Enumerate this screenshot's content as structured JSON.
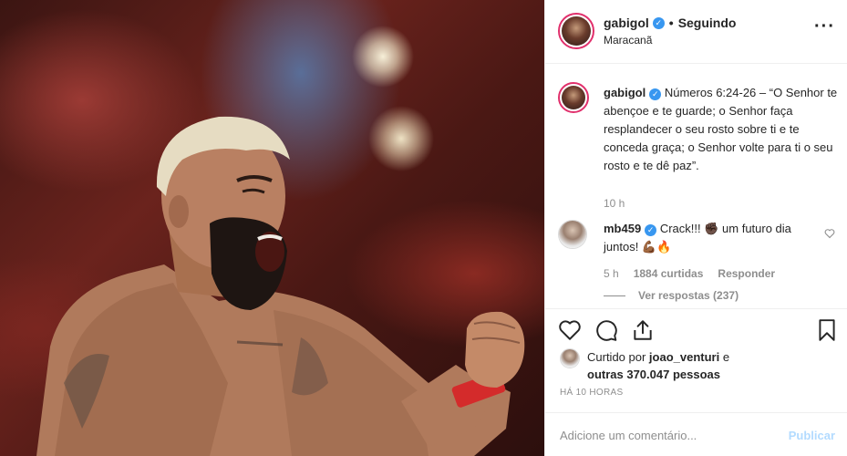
{
  "post": {
    "username": "gabigol",
    "follow_state": "Seguindo",
    "location": "Maracanã",
    "more_icon": "more-horizontal-icon"
  },
  "caption": {
    "username": "gabigol",
    "text": "Números 6:24-26 – “O Senhor te abençoe e te guarde; o Senhor faça resplandecer o seu rosto sobre ti e te conceda graça; o Senhor volte para ti o seu rosto e te dê paz”.",
    "time": "10 h"
  },
  "comment": {
    "username": "mb459",
    "text_part1": "Crack!!! ",
    "emoji1": "✊🏿",
    "text_part2": " um futuro dia juntos! ",
    "emoji2": "💪🏾🔥",
    "time": "5 h",
    "likes": "1884 curtidas",
    "reply_label": "Responder",
    "view_replies": "Ver respostas (237)"
  },
  "likes": {
    "prefix": "Curtido por ",
    "user": "joao_venturi",
    "middle": " e ",
    "others": "outras 370.047 pessoas"
  },
  "timestamp": "HÁ 10 HORAS",
  "add_comment": {
    "placeholder": "Adicione um comentário...",
    "publish_label": "Publicar"
  },
  "colors": {
    "verified": "#3897f0",
    "story_ring": "#e1306c",
    "publish_disabled": "#b3dbff",
    "muted": "#8e8e8e"
  }
}
